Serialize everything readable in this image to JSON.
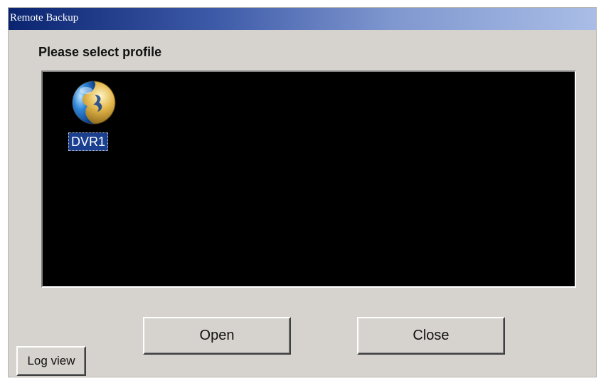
{
  "window": {
    "title": "Remote Backup"
  },
  "prompt": "Please select profile",
  "profiles": [
    {
      "label": "DVR1",
      "icon": "dvr-profile-icon",
      "selected": true
    }
  ],
  "buttons": {
    "open": "Open",
    "close": "Close",
    "log_view": "Log view"
  },
  "colors": {
    "title_bar_start": "#0a2470",
    "title_bar_end": "#a9bde6",
    "list_background": "#000000",
    "selection": "#1a3f8f",
    "dialog_face": "#d6d3ce"
  }
}
